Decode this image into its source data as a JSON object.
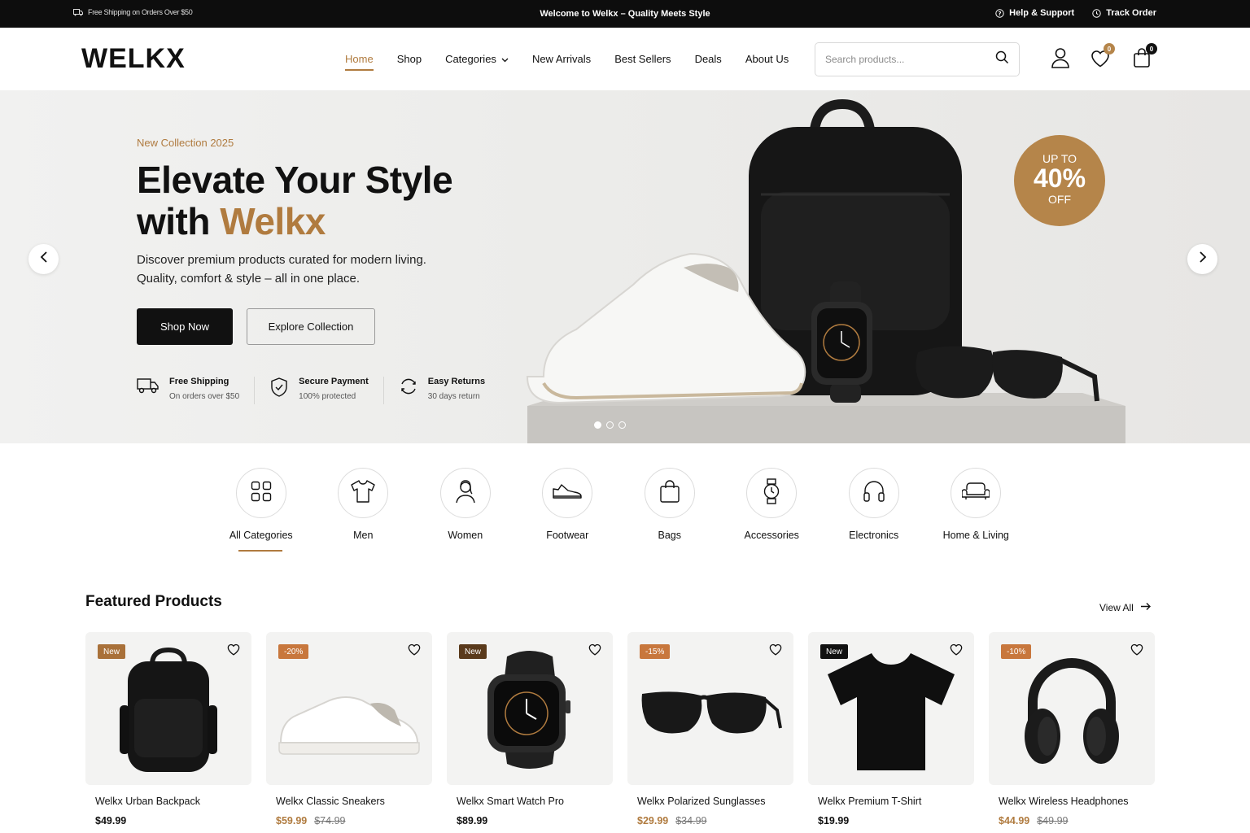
{
  "colors": {
    "accent": "#b07b3f",
    "dark": "#111111",
    "tag_new": "#a9713a",
    "tag_sale": "#c8773d",
    "badge": "#a77540"
  },
  "topbar": {
    "left_text": "Free Shipping on Orders Over $50",
    "center_text": "Welcome to Welkx – Quality Meets Style",
    "help": "Help & Support",
    "track": "Track Order"
  },
  "header": {
    "logo": "WELKX",
    "nav": [
      "Home",
      "Shop",
      "Categories",
      "New Arrivals",
      "Best Sellers",
      "Deals",
      "About Us"
    ],
    "active_nav": "Home",
    "search_placeholder": "Search products...",
    "wishlist_count": "0",
    "cart_count": "0"
  },
  "hero": {
    "eyebrow": "New Collection 2025",
    "title_line1": "Elevate Your Style",
    "title_with": "with ",
    "title_accent": "Welkx",
    "description": "Discover premium products curated for modern living. Quality, comfort & style – all in one place.",
    "primary_cta": "Shop Now",
    "secondary_cta": "Explore Collection",
    "features": [
      {
        "icon": "truck-icon",
        "title": "Free Shipping",
        "subtitle": "On orders over $50"
      },
      {
        "icon": "shield-icon",
        "title": "Secure Payment",
        "subtitle": "100% protected"
      },
      {
        "icon": "refresh-icon",
        "title": "Easy Returns",
        "subtitle": "30 days return"
      }
    ],
    "promo": {
      "line1": "UP TO",
      "line2": "40%",
      "line3": "OFF"
    },
    "slides": 3,
    "active_slide": 1
  },
  "categories": {
    "active": "All Categories",
    "items": [
      {
        "label": "All Categories",
        "icon": "grid-icon"
      },
      {
        "label": "Men",
        "icon": "tshirt-icon"
      },
      {
        "label": "Women",
        "icon": "woman-icon"
      },
      {
        "label": "Footwear",
        "icon": "shoe-icon"
      },
      {
        "label": "Bags",
        "icon": "bag-icon"
      },
      {
        "label": "Accessories",
        "icon": "watch-icon"
      },
      {
        "label": "Electronics",
        "icon": "headphones-icon"
      },
      {
        "label": "Home & Living",
        "icon": "sofa-icon"
      }
    ]
  },
  "featured": {
    "title": "Featured Products",
    "view_all": "View All",
    "products": [
      {
        "name": "Welkx Urban Backpack",
        "price": "$49.99",
        "old_price": "",
        "tag": "New",
        "tag_type": "new",
        "icon": "backpack-icon"
      },
      {
        "name": "Welkx Classic Sneakers",
        "price": "$59.99",
        "old_price": "$74.99",
        "tag": "-20%",
        "tag_type": "sale",
        "icon": "sneaker-icon"
      },
      {
        "name": "Welkx Smart Watch Pro",
        "price": "$89.99",
        "old_price": "",
        "tag": "New",
        "tag_type": "new-dark",
        "icon": "smartwatch-icon"
      },
      {
        "name": "Welkx Polarized Sunglasses",
        "price": "$29.99",
        "old_price": "$34.99",
        "tag": "-15%",
        "tag_type": "sale",
        "icon": "sunglasses-icon"
      },
      {
        "name": "Welkx Premium T-Shirt",
        "price": "$19.99",
        "old_price": "",
        "tag": "New",
        "tag_type": "black",
        "icon": "tshirt-icon"
      },
      {
        "name": "Welkx Wireless Headphones",
        "price": "$44.99",
        "old_price": "$49.99",
        "tag": "-10%",
        "tag_type": "sale",
        "icon": "headphones-icon"
      }
    ]
  }
}
